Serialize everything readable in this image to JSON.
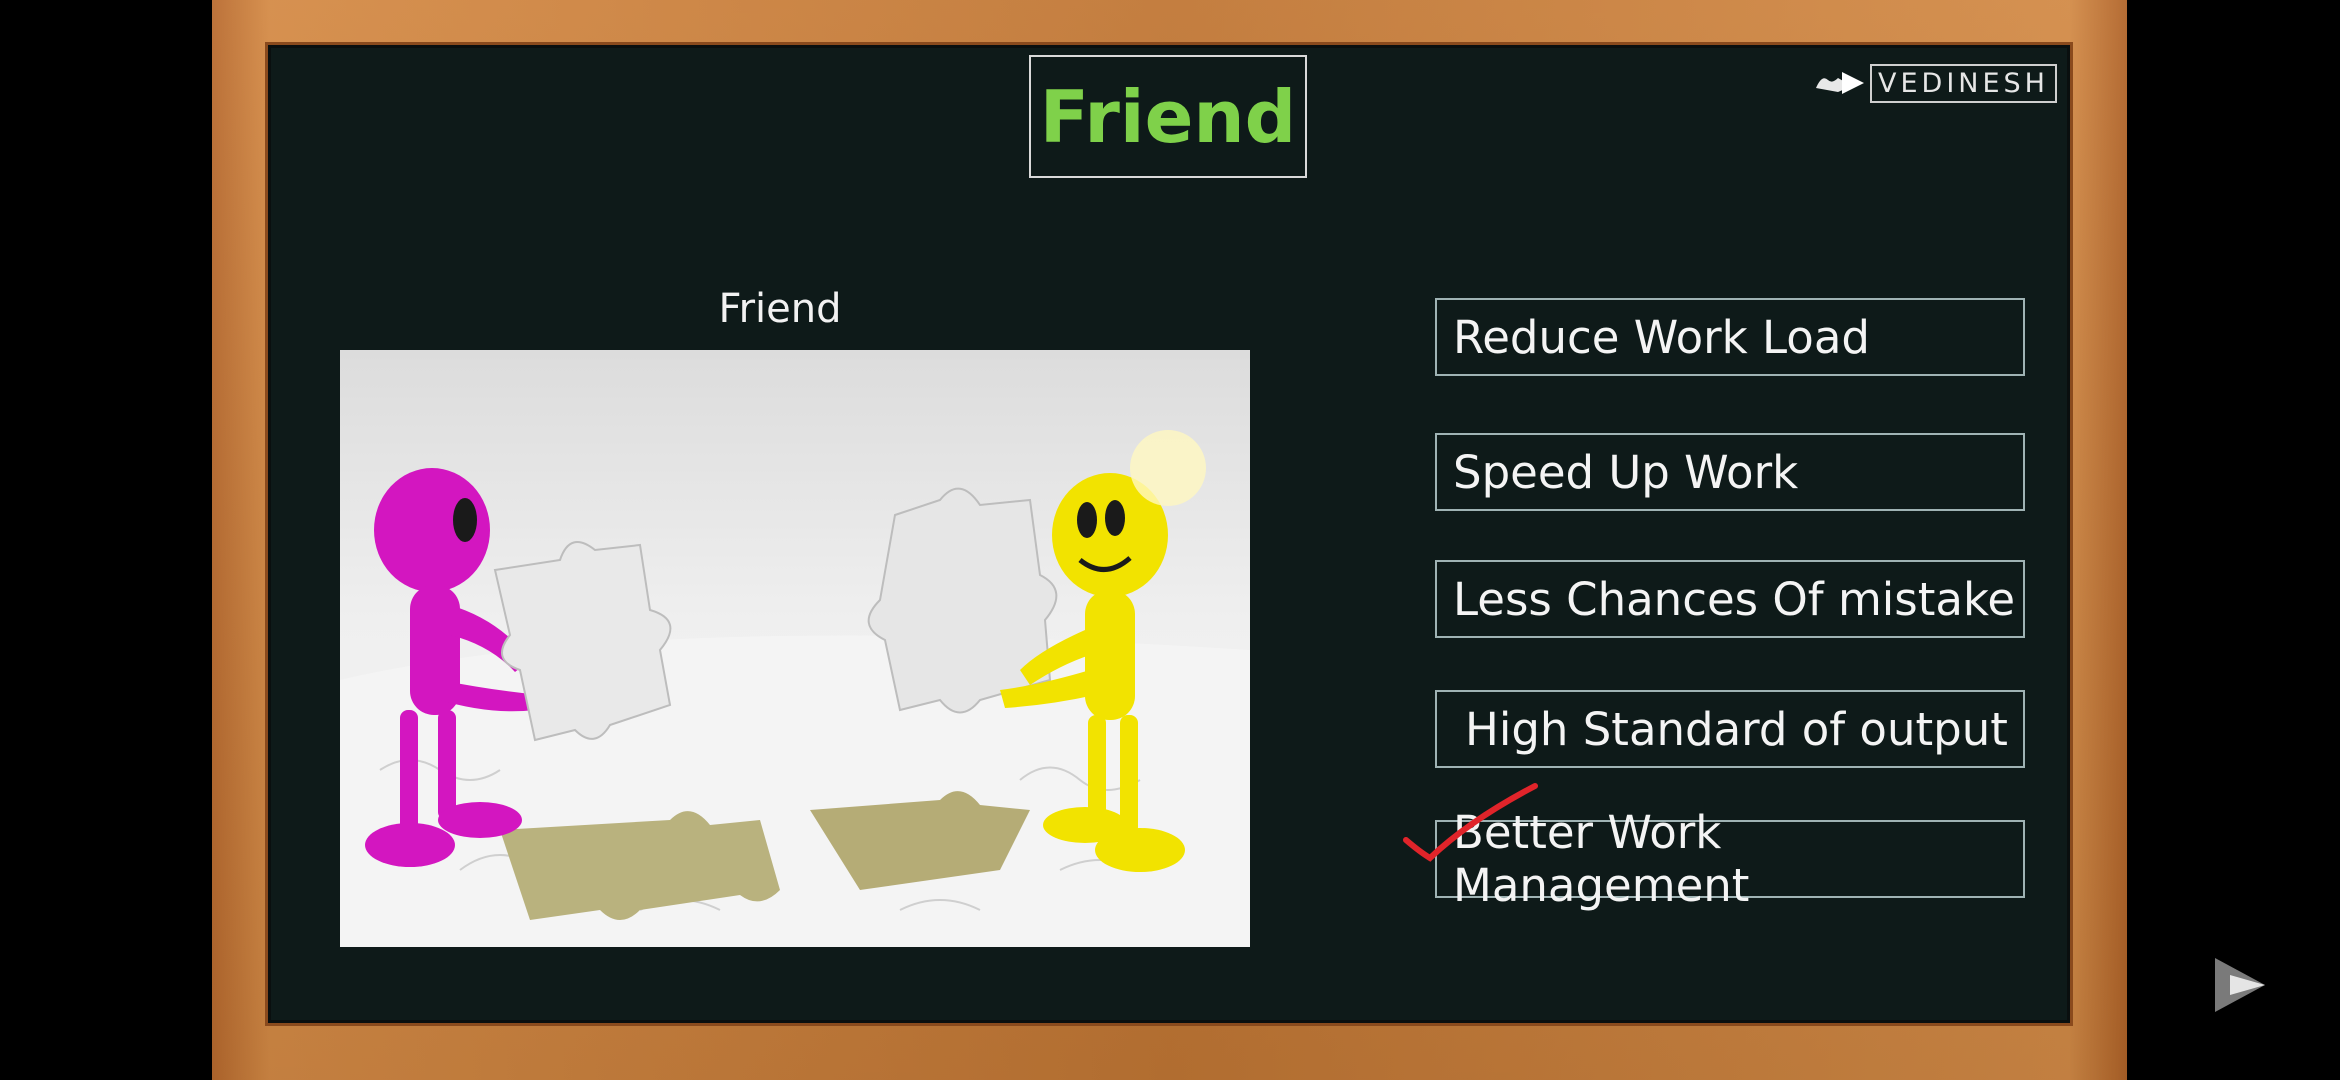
{
  "slide": {
    "title": "Friend",
    "logo_text": "VEDINESH",
    "picture_caption": "Friend",
    "items": [
      "Reduce Work Load",
      "Speed Up Work",
      "Less Chances Of mistake",
      "High Standard of output",
      "Better Work Management"
    ]
  },
  "colors": {
    "title": "#7fd14a",
    "board": "#0e1a19",
    "frame": "#c07634",
    "check": "#e0242a"
  },
  "icons": {
    "checkmark": "red-checkmark-icon",
    "player": "play-triangle-icon",
    "logo": "vedinesh-logo-icon"
  }
}
